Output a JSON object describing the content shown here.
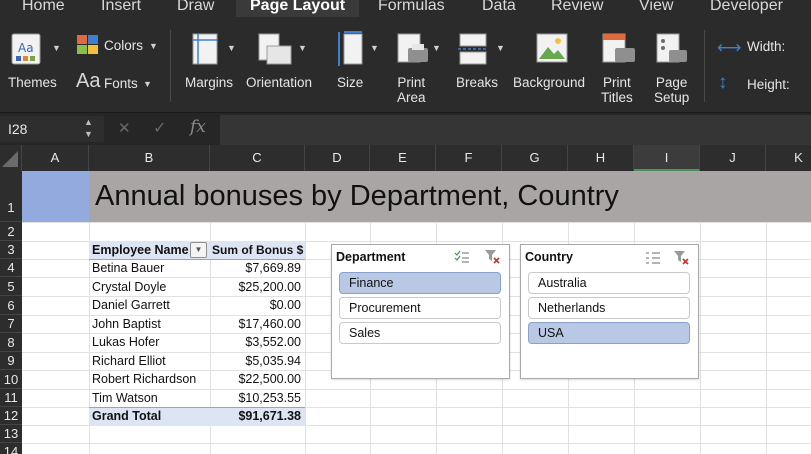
{
  "ribbon": {
    "tabs": [
      "Home",
      "Insert",
      "Draw",
      "Page Layout",
      "Formulas",
      "Data",
      "Review",
      "View",
      "Developer"
    ],
    "active_tab": "Page Layout",
    "themes_label": "Themes",
    "colors_label": "Colors",
    "fonts_label": "Fonts",
    "margins_label": "Margins",
    "orientation_label": "Orientation",
    "size_label": "Size",
    "print_area_label": "Print\nArea",
    "breaks_label": "Breaks",
    "background_label": "Background",
    "print_titles_label": "Print\nTitles",
    "page_setup_label": "Page\nSetup",
    "width_label": "Width:",
    "height_label": "Height:"
  },
  "formula_bar": {
    "name_box": "I28",
    "cancel_icon": "✕",
    "enter_icon": "✓",
    "fx_icon": "fx",
    "formula": ""
  },
  "sheet": {
    "columns": [
      "A",
      "B",
      "C",
      "D",
      "E",
      "F",
      "G",
      "H",
      "I",
      "J",
      "K"
    ],
    "selected_column": "I",
    "rows": [
      "1",
      "2",
      "3",
      "4",
      "5",
      "6",
      "7",
      "8",
      "9",
      "10",
      "11",
      "12",
      "13",
      "14"
    ],
    "title": "Annual bonuses by Department, Country",
    "pivot": {
      "header_name": "Employee Name",
      "header_value": "Sum of Bonus $",
      "rows": [
        {
          "name": "Betina Bauer",
          "value": "$7,669.89"
        },
        {
          "name": "Crystal Doyle",
          "value": "$25,200.00"
        },
        {
          "name": "Daniel Garrett",
          "value": "$0.00"
        },
        {
          "name": "John Baptist",
          "value": "$17,460.00"
        },
        {
          "name": "Lukas Hofer",
          "value": "$3,552.00"
        },
        {
          "name": "Richard Elliot",
          "value": "$5,035.94"
        },
        {
          "name": "Robert Richardson",
          "value": "$22,500.00"
        },
        {
          "name": "Tim Watson",
          "value": "$10,253.55"
        }
      ],
      "total_label": "Grand Total",
      "total_value": "$91,671.38"
    },
    "slicers": [
      {
        "title": "Department",
        "items": [
          {
            "label": "Finance",
            "selected": true
          },
          {
            "label": "Procurement",
            "selected": false
          },
          {
            "label": "Sales",
            "selected": false
          }
        ]
      },
      {
        "title": "Country",
        "items": [
          {
            "label": "Australia",
            "selected": false
          },
          {
            "label": "Netherlands",
            "selected": false
          },
          {
            "label": "USA",
            "selected": true
          }
        ]
      }
    ]
  },
  "colors": {
    "title_band": "#a9a5a5",
    "cell_a1": "#93aadf",
    "slicer_selected": "#b9c8e4",
    "total_row": "#dde5f4"
  }
}
